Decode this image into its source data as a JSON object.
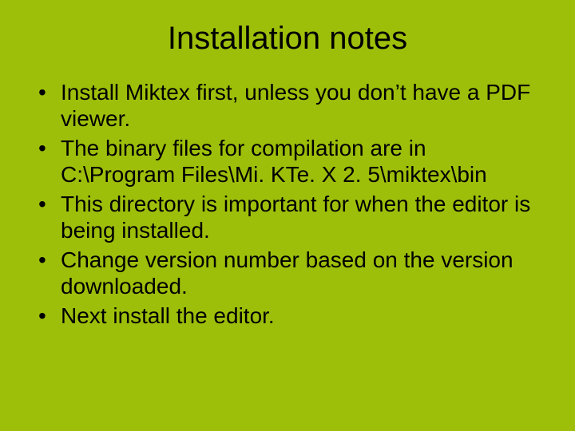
{
  "slide": {
    "title": "Installation notes",
    "bullets": [
      "Install Miktex first, unless you don’t have a PDF  viewer.",
      "The binary files for compilation are in C:\\Program Files\\Mi. KTe. X 2. 5\\miktex\\bin",
      "This directory is important for when the editor is being installed.",
      "Change version number based on the version downloaded.",
      "Next install the editor."
    ]
  }
}
